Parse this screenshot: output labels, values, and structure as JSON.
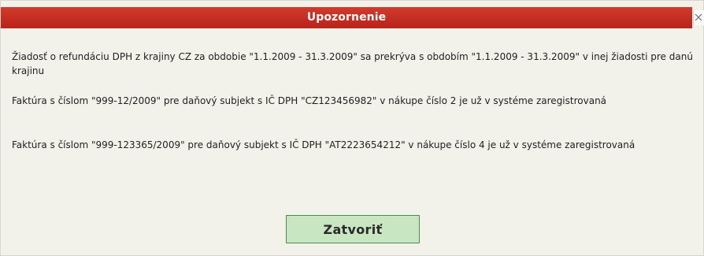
{
  "dialog": {
    "title": "Upozornenie",
    "close_symbol": "×",
    "messages": [
      "Žiadosť o refundáciu DPH z krajiny CZ za obdobie \"1.1.2009 - 31.3.2009\" sa prekrýva s obdobím \"1.1.2009 - 31.3.2009\" v inej žiadosti pre danú krajinu",
      "Faktúra s číslom \"999-12/2009\" pre daňový subjekt s IČ DPH \"CZ123456982\" v nákupe číslo 2 je už v systéme zaregistrovaná",
      "Faktúra s číslom \"999-123365/2009\" pre daňový subjekt s IČ DPH \"AT2223654212\" v nákupe číslo 4 je už v systéme zaregistrovaná"
    ],
    "close_button_label": "Zatvoriť"
  },
  "colors": {
    "title_bar": "#c92b21",
    "title_text": "#ffffff",
    "dialog_background": "#f2f1ea",
    "button_background": "#c9e6c3",
    "button_border": "#4d8d45"
  },
  "icons": {
    "close": "close-icon"
  }
}
